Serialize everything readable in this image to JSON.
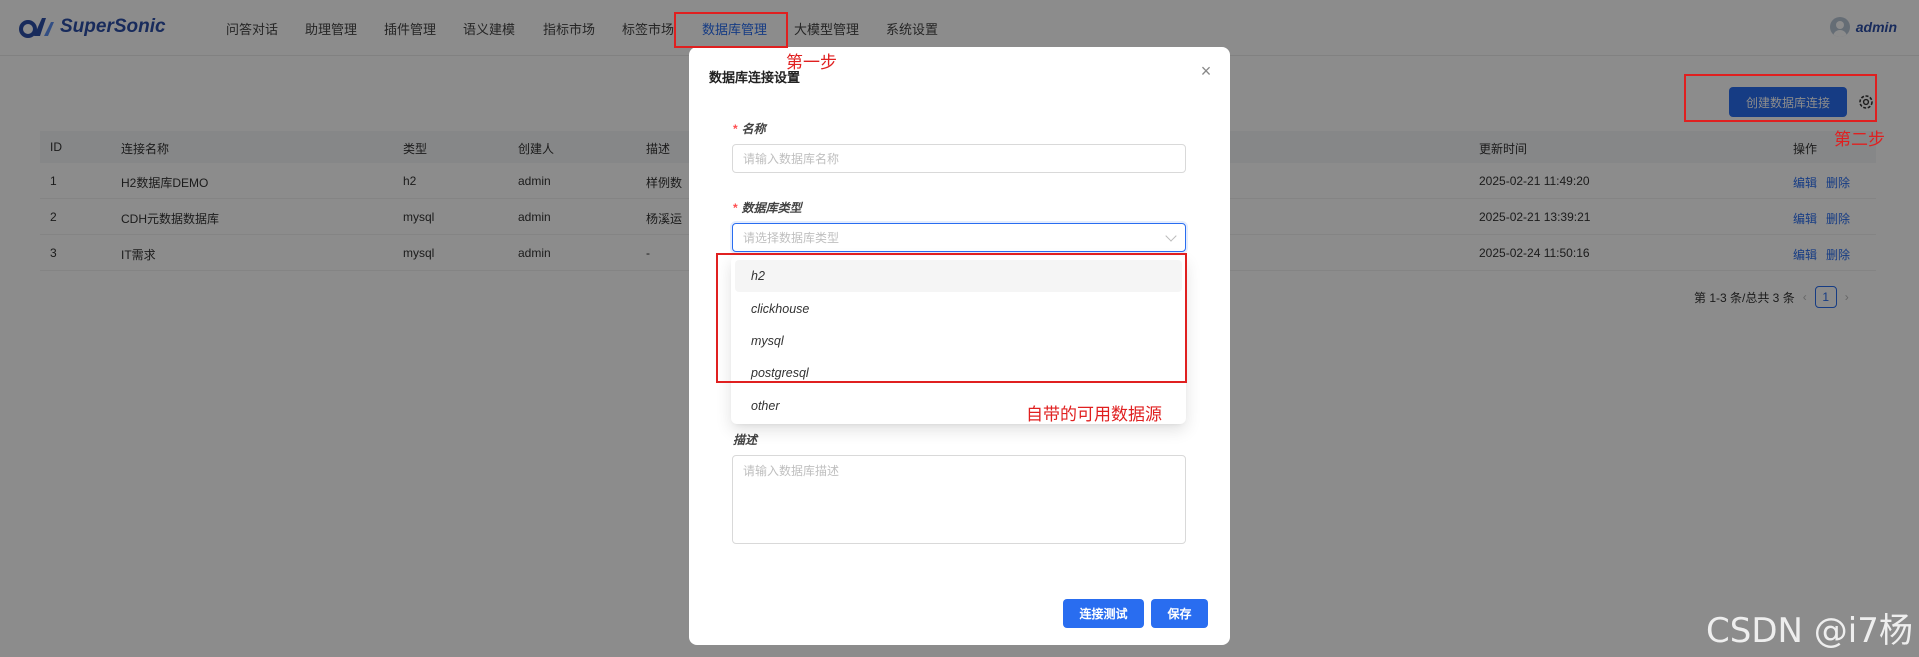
{
  "app": {
    "name": "SuperSonic",
    "user": "admin"
  },
  "nav": {
    "items": [
      {
        "label": "问答对话"
      },
      {
        "label": "助理管理"
      },
      {
        "label": "插件管理"
      },
      {
        "label": "语义建模"
      },
      {
        "label": "指标市场"
      },
      {
        "label": "标签市场"
      },
      {
        "label": "数据库管理",
        "active": true
      },
      {
        "label": "大模型管理"
      },
      {
        "label": "系统设置"
      }
    ]
  },
  "page": {
    "create_button": "创建数据库连接",
    "gear_icon": "gear-icon",
    "table": {
      "headers": [
        "ID",
        "连接名称",
        "类型",
        "创建人",
        "描述",
        "更新时间",
        "操作"
      ],
      "rows": [
        {
          "id": "1",
          "name": "H2数据库DEMO",
          "type": "h2",
          "creator": "admin",
          "desc": "样例数",
          "updated": "2025-02-21 11:49:20",
          "edit": "编辑",
          "delete": "删除"
        },
        {
          "id": "2",
          "name": "CDH元数据数据库",
          "type": "mysql",
          "creator": "admin",
          "desc": "杨溪运",
          "updated": "2025-02-21 13:39:21",
          "edit": "编辑",
          "delete": "删除"
        },
        {
          "id": "3",
          "name": "IT需求",
          "type": "mysql",
          "creator": "admin",
          "desc": "-",
          "updated": "2025-02-24 11:50:16",
          "edit": "编辑",
          "delete": "删除"
        }
      ]
    },
    "pagination": {
      "summary": "第 1-3 条/总共 3 条",
      "current": "1",
      "prev": "‹",
      "next": "›"
    }
  },
  "modal": {
    "title": "数据库连接设置",
    "close": "×",
    "name_label": "名称",
    "name_placeholder": "请输入数据库名称",
    "type_label": "数据库类型",
    "type_placeholder": "请选择数据库类型",
    "desc_label": "描述",
    "desc_placeholder": "请输入数据库描述",
    "required_mark": "*",
    "test_button": "连接测试",
    "save_button": "保存",
    "options": [
      "h2",
      "clickhouse",
      "mysql",
      "postgresql",
      "other"
    ]
  },
  "annotations": {
    "step1": "第一步",
    "step2": "第二步",
    "builtin": "自带的可用数据源"
  },
  "watermark": "CSDN @i7杨",
  "colors": {
    "primary": "#296df0",
    "annotation": "#e02020",
    "brand": "#2d4fa8"
  }
}
